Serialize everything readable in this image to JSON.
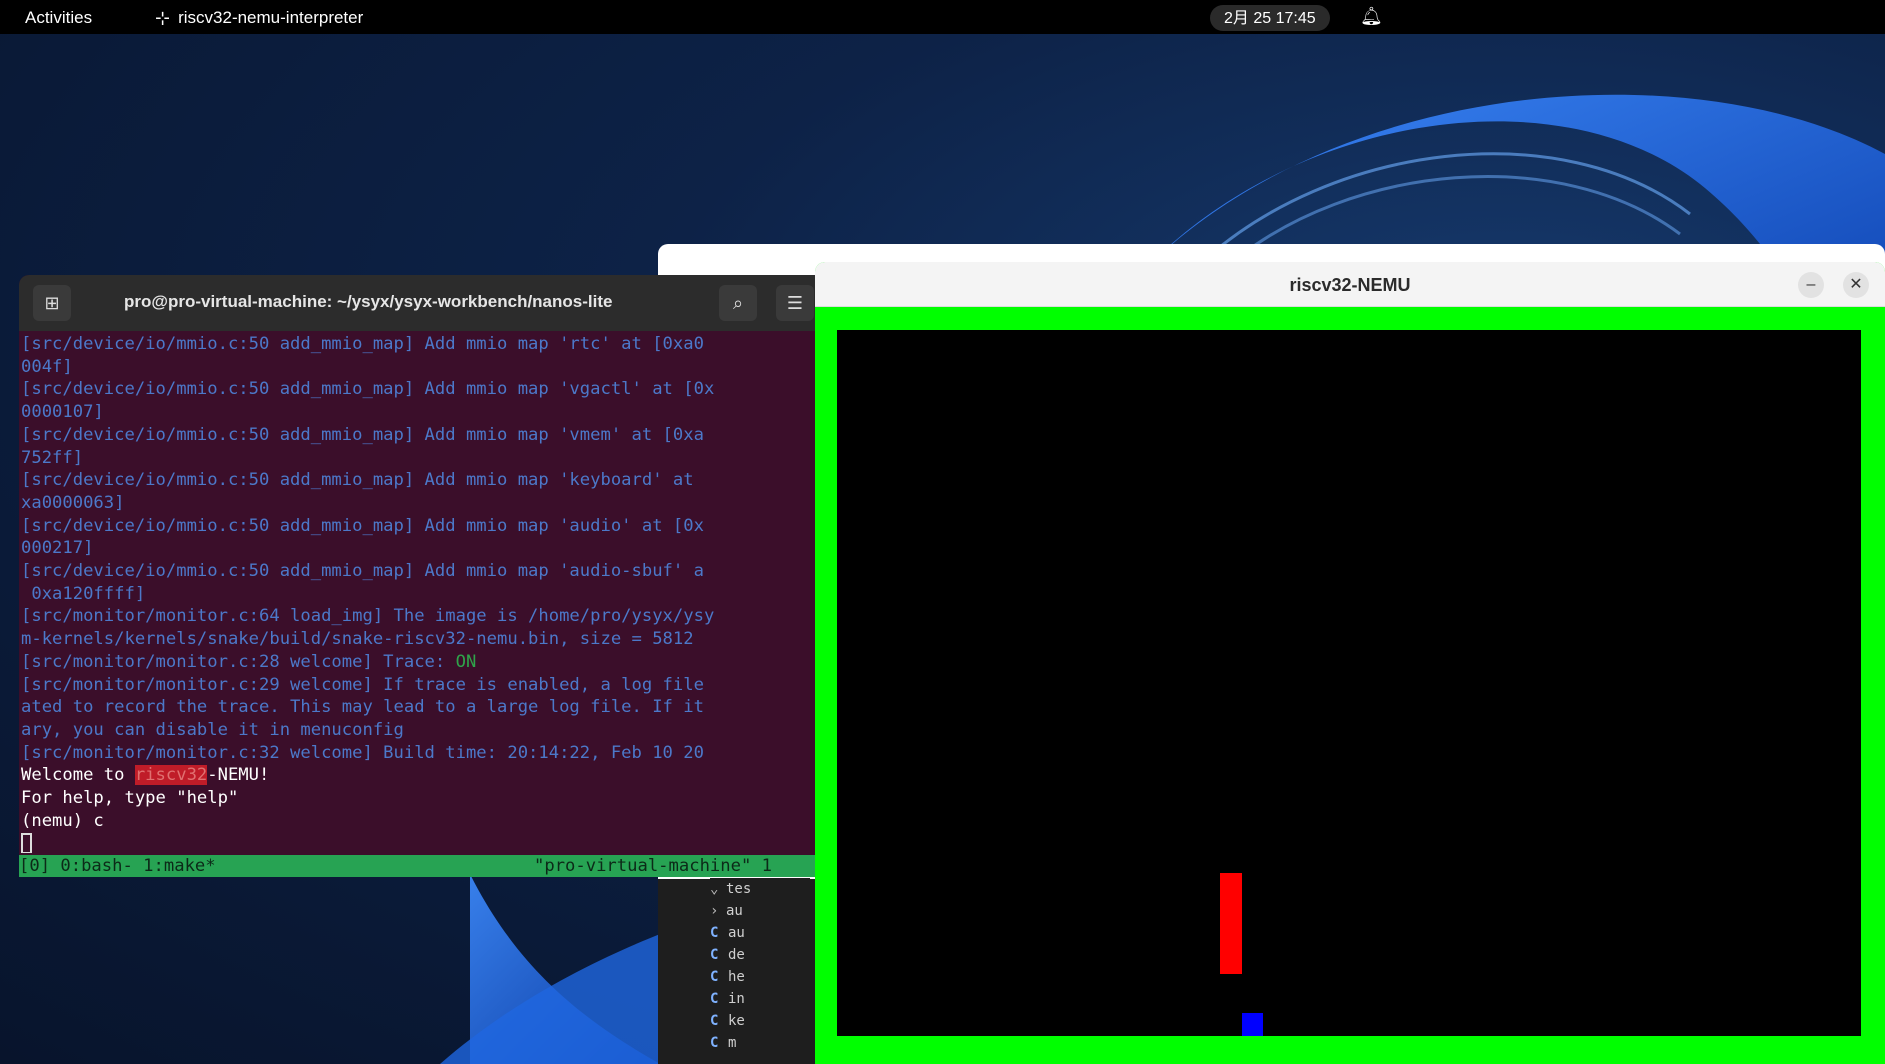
{
  "topbar": {
    "activities": "Activities",
    "app_name": "riscv32-nemu-interpreter",
    "clock": "2月 25  17:45"
  },
  "terminal": {
    "title": "pro@pro-virtual-machine: ~/ysyx/ysyx-workbench/nanos-lite",
    "lines": [
      {
        "cls": "log",
        "text": "[src/device/io/mmio.c:50 add_mmio_map] Add mmio map 'rtc' at [0xa0"
      },
      {
        "cls": "log",
        "text": "004f]"
      },
      {
        "cls": "log",
        "text": "[src/device/io/mmio.c:50 add_mmio_map] Add mmio map 'vgactl' at [0x"
      },
      {
        "cls": "log",
        "text": "0000107]"
      },
      {
        "cls": "log",
        "text": "[src/device/io/mmio.c:50 add_mmio_map] Add mmio map 'vmem' at [0xa"
      },
      {
        "cls": "log",
        "text": "752ff]"
      },
      {
        "cls": "log",
        "text": "[src/device/io/mmio.c:50 add_mmio_map] Add mmio map 'keyboard' at "
      },
      {
        "cls": "log",
        "text": "xa0000063]"
      },
      {
        "cls": "log",
        "text": "[src/device/io/mmio.c:50 add_mmio_map] Add mmio map 'audio' at [0x"
      },
      {
        "cls": "log",
        "text": "000217]"
      },
      {
        "cls": "log",
        "text": "[src/device/io/mmio.c:50 add_mmio_map] Add mmio map 'audio-sbuf' a"
      },
      {
        "cls": "log",
        "text": " 0xa120ffff]"
      },
      {
        "cls": "log",
        "text": "[src/monitor/monitor.c:64 load_img] The image is /home/pro/ysyx/ysy"
      },
      {
        "cls": "log",
        "text": "m-kernels/kernels/snake/build/snake-riscv32-nemu.bin, size = 5812"
      }
    ],
    "trace_prefix": "[src/monitor/monitor.c:28 welcome] Trace: ",
    "trace_on": "ON",
    "lines2": [
      "[src/monitor/monitor.c:29 welcome] If trace is enabled, a log file",
      "ated to record the trace. This may lead to a large log file. If it",
      "ary, you can disable it in menuconfig",
      "[src/monitor/monitor.c:32 welcome] Build time: 20:14:22, Feb 10 20"
    ],
    "welcome_pre": "Welcome to ",
    "welcome_hl": "riscv32",
    "welcome_post": "-NEMU!",
    "help": "For help, type \"help\"",
    "prompt": "(nemu) c",
    "status_left": "[0] 0:bash- 1:make*",
    "status_right": "\"pro-virtual-machine\" 1"
  },
  "nemu_window": {
    "title": "riscv32-NEMU",
    "minimize": "–",
    "close": "✕"
  },
  "tree": {
    "rows": [
      {
        "icon": "chevron-down",
        "label": "tes"
      },
      {
        "icon": "chevron-right",
        "label": "au"
      },
      {
        "icon": "c",
        "label": "au"
      },
      {
        "icon": "c",
        "label": "de"
      },
      {
        "icon": "c",
        "label": "he"
      },
      {
        "icon": "c",
        "label": "in"
      },
      {
        "icon": "c",
        "label": "ke"
      },
      {
        "icon": "c",
        "label": "m"
      }
    ]
  },
  "colors": {
    "terminal_bg": "#3b0e2a",
    "log_text": "#4c78c9",
    "status_green": "#27a353",
    "nemu_border": "#00ff00",
    "snake": "#ff0000",
    "food": "#0000ff"
  }
}
